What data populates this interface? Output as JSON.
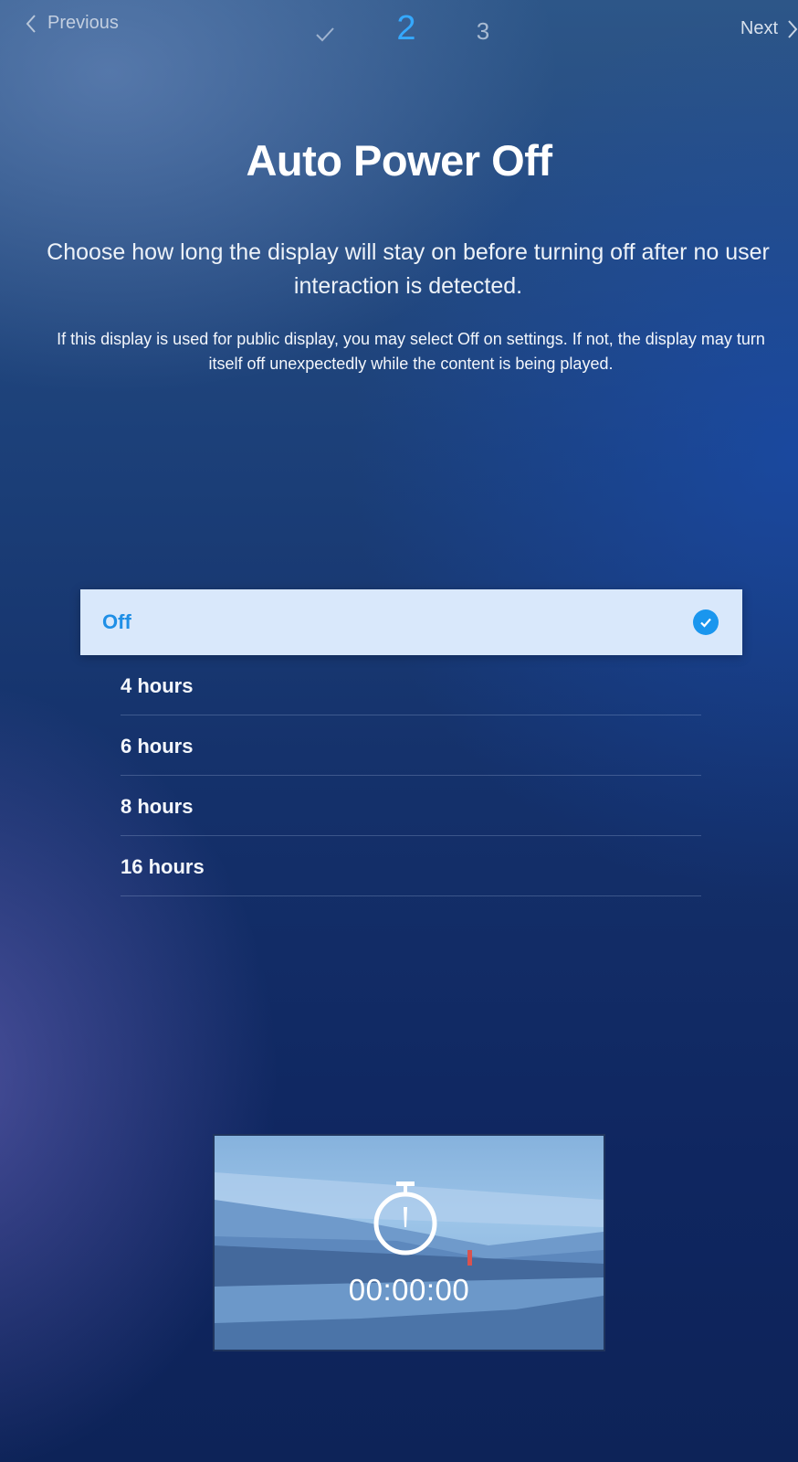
{
  "nav": {
    "previous_label": "Previous",
    "next_label": "Next",
    "step_current": "2",
    "step_next": "3"
  },
  "page": {
    "title": "Auto Power Off",
    "description": "Choose how long the display will stay on before turning off after no user interaction is detected.",
    "note": "If this display is used for public display, you may select Off on settings. If not, the display may turn itself off unexpectedly while the content is being played."
  },
  "options": {
    "selected": "Off",
    "items": [
      "4 hours",
      "6 hours",
      "8 hours",
      "16 hours"
    ]
  },
  "preview": {
    "timer": "00:00:00"
  },
  "colors": {
    "accent": "#35a9ff",
    "selected_bg": "#d9e8fb",
    "selected_text": "#1f8fe6"
  },
  "icons": {
    "previous": "chevron-left-icon",
    "next": "chevron-right-icon",
    "completed_step": "checkmark-icon",
    "selected": "check-circle-icon",
    "timer": "stopwatch-icon"
  }
}
